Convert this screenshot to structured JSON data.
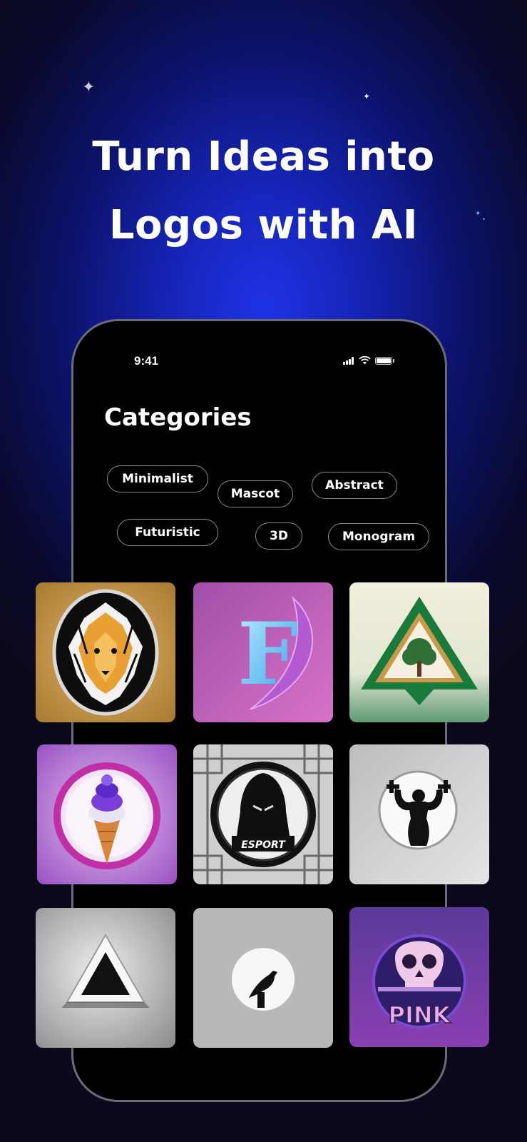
{
  "headline": {
    "line1": "Turn Ideas into",
    "line2": "Logos with AI"
  },
  "status_bar": {
    "time": "9:41",
    "icons": [
      "cellular-signal-icon",
      "wifi-icon",
      "battery-icon"
    ]
  },
  "screen": {
    "title": "Categories",
    "chips": [
      "Minimalist",
      "Mascot",
      "Abstract",
      "Futuristic",
      "3D",
      "Monogram"
    ]
  },
  "logo_grid": {
    "items": [
      {
        "name": "lion-emblem-logo"
      },
      {
        "name": "letter-f-monogram-logo",
        "letter": "F"
      },
      {
        "name": "tree-triangle-logo"
      },
      {
        "name": "ice-cream-logo"
      },
      {
        "name": "esport-hooded-logo",
        "text": "ESPORT"
      },
      {
        "name": "bodybuilder-logo"
      },
      {
        "name": "triangle-3d-logo"
      },
      {
        "name": "bird-silhouette-logo"
      },
      {
        "name": "pink-skull-logo",
        "text": "PINK"
      }
    ]
  },
  "colors": {
    "background_glow": "#1f33e6",
    "background_dark": "#0b0a1c",
    "phone_frame": "#6c6c78",
    "chip_border": "#8a8a8a",
    "text": "#ffffff"
  }
}
